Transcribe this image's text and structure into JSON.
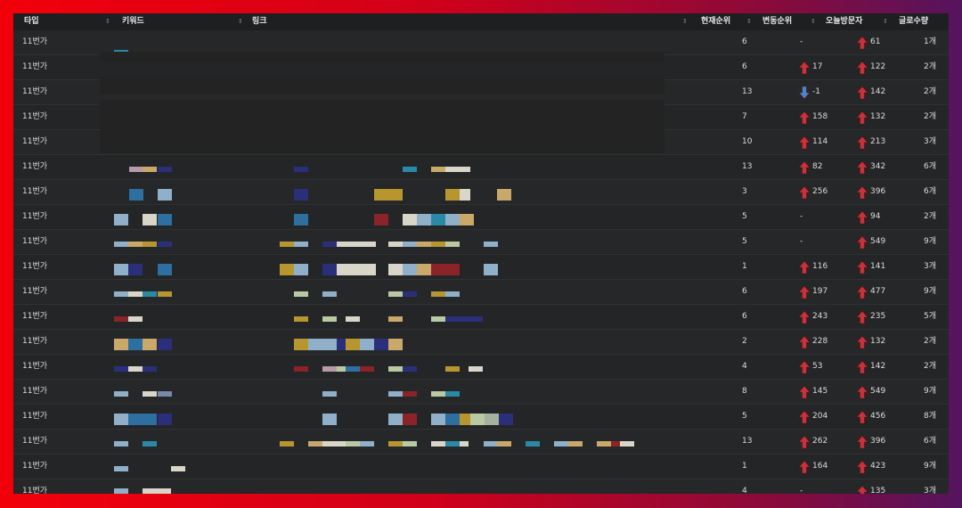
{
  "table": {
    "headers": {
      "type": "타입",
      "keyword": "키워드",
      "link": "링크",
      "current_rank": "현재순위",
      "rank_change": "변동순위",
      "visitors_today": "오늘방문자",
      "post_count": "글로수량"
    },
    "rows": [
      {
        "type": "11번가",
        "rank": "6",
        "change": "-",
        "change_dir": "none",
        "visitors": "61",
        "posts": "1개"
      },
      {
        "type": "11번가",
        "rank": "6",
        "change": "17",
        "change_dir": "up",
        "visitors": "122",
        "posts": "2개"
      },
      {
        "type": "11번가",
        "rank": "13",
        "change": "-1",
        "change_dir": "down",
        "visitors": "142",
        "posts": "2개"
      },
      {
        "type": "11번가",
        "rank": "7",
        "change": "158",
        "change_dir": "up",
        "visitors": "132",
        "posts": "2개"
      },
      {
        "type": "11번가",
        "rank": "10",
        "change": "114",
        "change_dir": "up",
        "visitors": "213",
        "posts": "3개"
      },
      {
        "type": "11번가",
        "rank": "13",
        "change": "82",
        "change_dir": "up",
        "visitors": "342",
        "posts": "6개"
      },
      {
        "type": "11번가",
        "rank": "3",
        "change": "256",
        "change_dir": "up",
        "visitors": "396",
        "posts": "6개"
      },
      {
        "type": "11번가",
        "rank": "5",
        "change": "-",
        "change_dir": "none",
        "visitors": "94",
        "posts": "2개"
      },
      {
        "type": "11번가",
        "rank": "5",
        "change": "-",
        "change_dir": "none",
        "visitors": "549",
        "posts": "9개"
      },
      {
        "type": "11번가",
        "rank": "1",
        "change": "116",
        "change_dir": "up",
        "visitors": "141",
        "posts": "3개"
      },
      {
        "type": "11번가",
        "rank": "6",
        "change": "197",
        "change_dir": "up",
        "visitors": "477",
        "posts": "9개"
      },
      {
        "type": "11번가",
        "rank": "6",
        "change": "243",
        "change_dir": "up",
        "visitors": "235",
        "posts": "5개"
      },
      {
        "type": "11번가",
        "rank": "2",
        "change": "228",
        "change_dir": "up",
        "visitors": "132",
        "posts": "2개"
      },
      {
        "type": "11번가",
        "rank": "4",
        "change": "53",
        "change_dir": "up",
        "visitors": "142",
        "posts": "2개"
      },
      {
        "type": "11번가",
        "rank": "8",
        "change": "145",
        "change_dir": "up",
        "visitors": "549",
        "posts": "9개"
      },
      {
        "type": "11번가",
        "rank": "5",
        "change": "204",
        "change_dir": "up",
        "visitors": "456",
        "posts": "8개"
      },
      {
        "type": "11번가",
        "rank": "13",
        "change": "262",
        "change_dir": "up",
        "visitors": "396",
        "posts": "6개"
      },
      {
        "type": "11번가",
        "rank": "1",
        "change": "164",
        "change_dir": "up",
        "visitors": "423",
        "posts": "9개"
      },
      {
        "type": "11번가",
        "rank": "4",
        "change": "-",
        "change_dir": "none",
        "visitors": "135",
        "posts": "3개"
      }
    ]
  },
  "icons": {
    "sort": "sort-arrows-icon",
    "up": "red-up-arrow-icon",
    "down": "blue-down-arrow-icon"
  },
  "colors": {
    "up_arrow": "#c8323a",
    "down_arrow": "#4a86c8",
    "frame_bg": "#262728",
    "header_bg": "#1e1f20"
  }
}
